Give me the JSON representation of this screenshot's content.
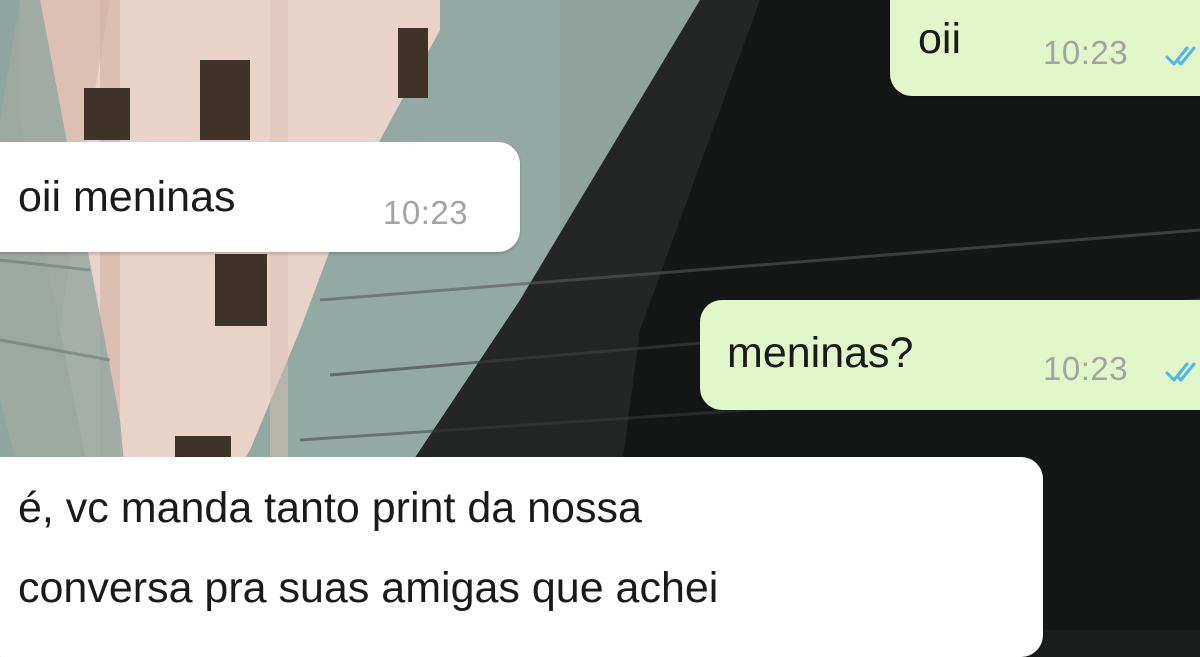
{
  "chat": {
    "messages": [
      {
        "direction": "outgoing",
        "text": "oii",
        "time": "10:23",
        "status_icon": "double-check-read-icon"
      },
      {
        "direction": "incoming",
        "text": "oii meninas",
        "time": "10:23"
      },
      {
        "direction": "outgoing",
        "text": "meninas?",
        "time": "10:23",
        "status_icon": "double-check-read-icon"
      },
      {
        "direction": "incoming",
        "lines": [
          "é, vc manda tanto print da nossa",
          "conversa pra suas amigas que achei"
        ]
      }
    ]
  },
  "colors": {
    "incoming_bubble": "#ffffff",
    "outgoing_bubble": "#e1f7c9",
    "timestamp": "#a3a3a3",
    "read_tick": "#4fb6ec",
    "wall_sky": "#8fa8a2",
    "wall_shadow": "#1b1d1c"
  }
}
